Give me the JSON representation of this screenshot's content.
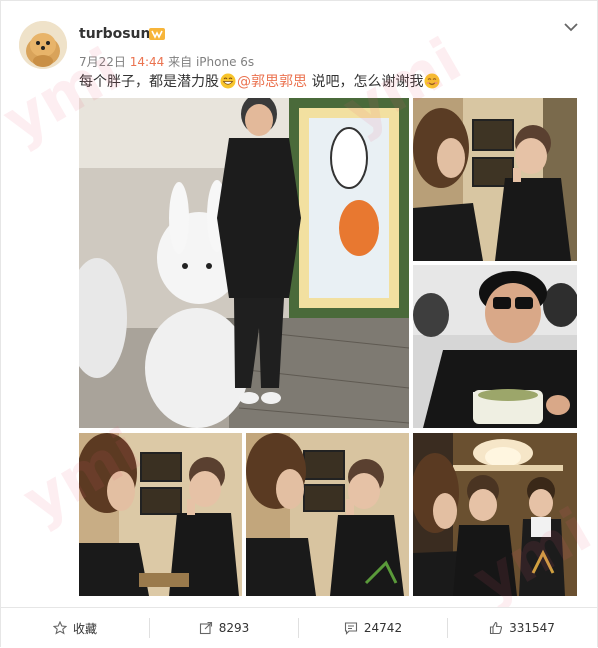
{
  "post": {
    "username": "turbosun",
    "date": "7月22日",
    "time": "14:44",
    "source": "来自 iPhone 6s",
    "text_before": "每个胖子，都是潜力股",
    "mention": "@郭思郭思",
    "text_after": " 说吧，怎么谢谢我"
  },
  "actions": {
    "favorite_label": "收藏",
    "repost_count": "8293",
    "comment_count": "24742",
    "like_count": "331547"
  },
  "watermark": "ymi",
  "colors": {
    "accent": "#eb7350",
    "text": "#333333",
    "muted": "#808080"
  },
  "icons": [
    "vip-badge-icon",
    "chevron-down-icon",
    "grin-emoji-icon",
    "smile-emoji-icon",
    "star-icon",
    "repost-icon",
    "comment-icon",
    "thumbs-up-icon"
  ]
}
